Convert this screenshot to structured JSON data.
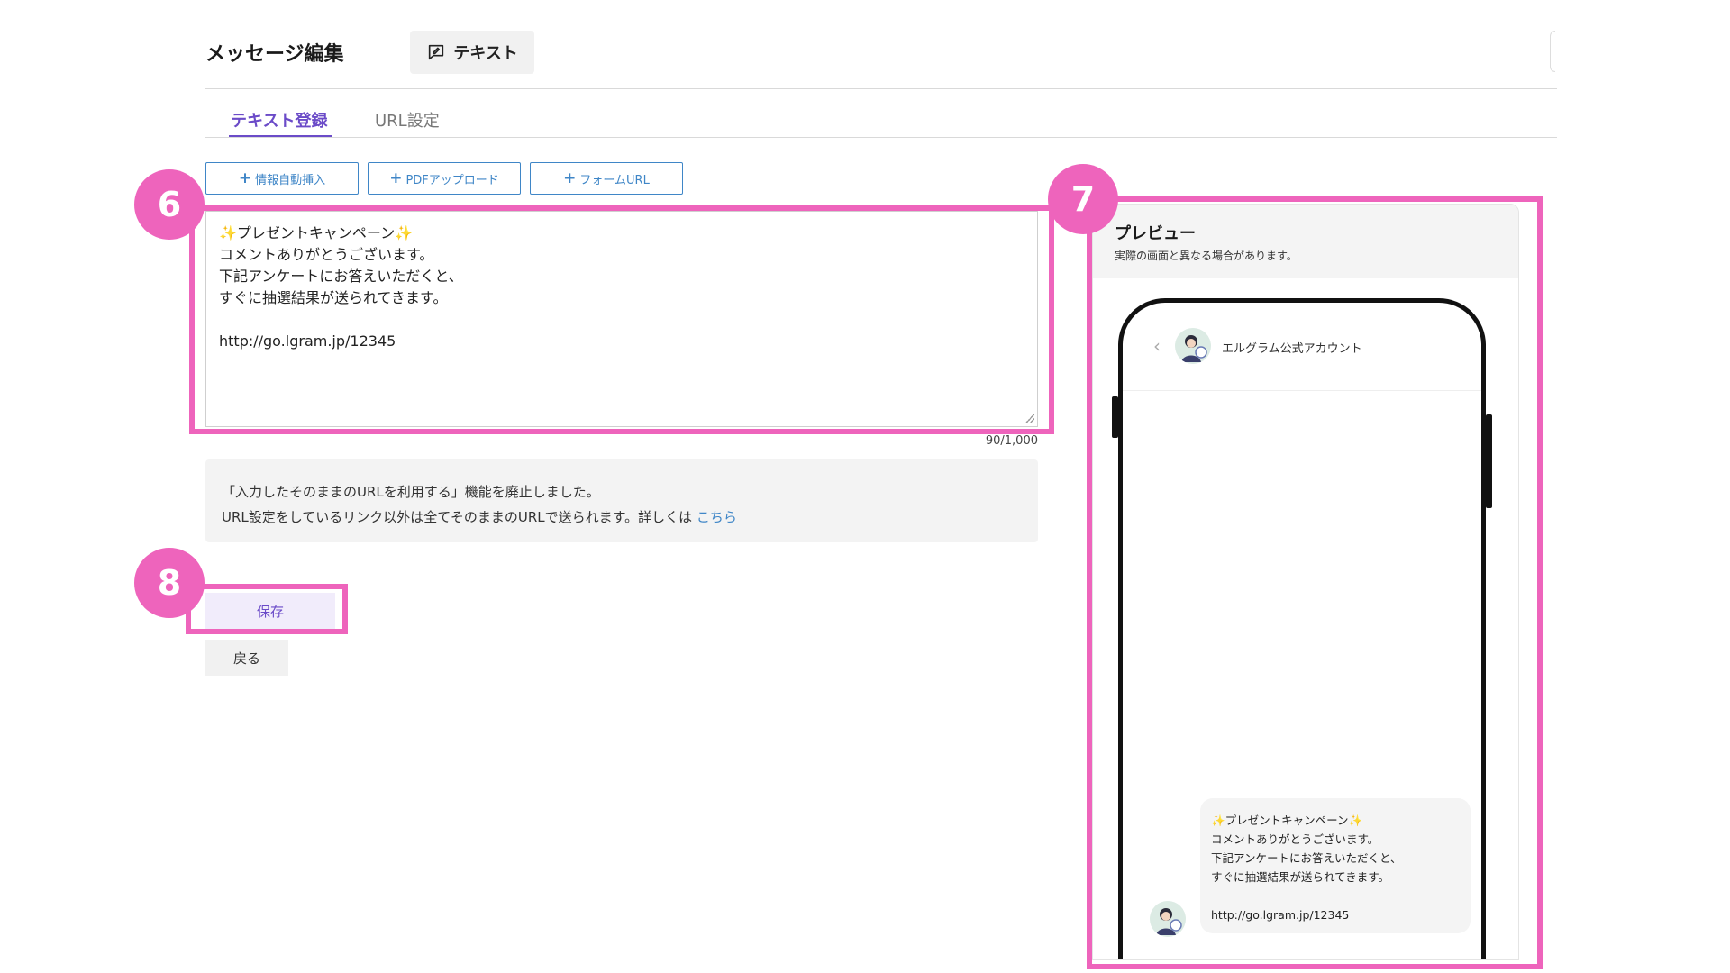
{
  "header": {
    "title": "メッセージ編集",
    "type_chip_label": "テキスト",
    "type_chip_icon": "chat-edit-icon"
  },
  "tabs": [
    {
      "label": "テキスト登録",
      "active": true
    },
    {
      "label": "URL設定",
      "active": false
    }
  ],
  "insert_buttons": [
    {
      "label": "情報自動挿入"
    },
    {
      "label": "PDFアップロード"
    },
    {
      "label": "フォームURL"
    }
  ],
  "editor": {
    "line1": "プレゼントキャンペーン",
    "line2": "コメントありがとうございます。",
    "line3": "下記アンケートにお答えいただくと、",
    "line4": "すぐに抽選結果が送られてきます。",
    "line5": "http://go.lgram.jp/12345",
    "char_count": "90/1,000"
  },
  "notice": {
    "line1": "「入力したそのままのURLを利用する」機能を廃止しました。",
    "line2": "URL設定をしているリンク以外は全てそのままのURLで送られます。詳しくは",
    "link_text": "こちら"
  },
  "actions": {
    "save_label": "保存",
    "back_label": "戻る"
  },
  "preview": {
    "title": "プレビュー",
    "subtitle": "実際の画面と異なる場合があります。",
    "account_name": "エルグラム公式アカウント",
    "message_line1": "プレゼントキャンペーン",
    "message_line2": "コメントありがとうございます。",
    "message_line3": "下記アンケートにお答えいただくと、",
    "message_line4": "すぐに抽選結果が送られてきます。",
    "message_url": "http://go.lgram.jp/12345"
  },
  "annotations": {
    "badge_6": "6",
    "badge_7": "7",
    "badge_8": "8",
    "highlight_color": "#ee64bc"
  },
  "colors": {
    "accent_purple": "#6b4bc8",
    "link_blue": "#3f86c7"
  }
}
